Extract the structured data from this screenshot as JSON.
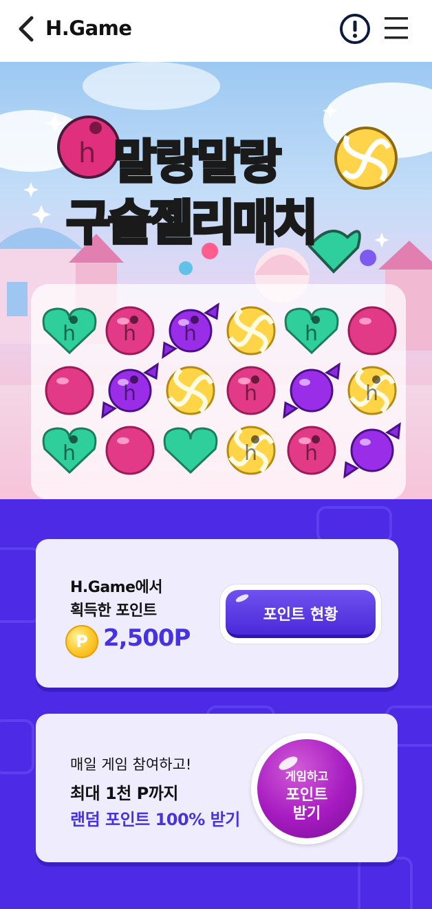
{
  "header": {
    "title": "H.Game",
    "back_icon": "chevron-left-icon",
    "info_icon": "info-circle-icon",
    "menu_icon": "hamburger-menu-icon"
  },
  "hero": {
    "title_line1": "말랑말랑",
    "title_line2": "구슬젤리매치",
    "board_tiles": [
      [
        "heart-h",
        "ball-h",
        "wrapped-h",
        "swirl",
        "heart-h",
        "ball"
      ],
      [
        "ball",
        "wrapped-h",
        "swirl",
        "ball-h",
        "wrapped",
        "swirl-h"
      ],
      [
        "heart-h",
        "ball",
        "heart",
        "swirl-h",
        "ball-h",
        "wrapped"
      ]
    ]
  },
  "points_card": {
    "label_line1": "H.Game에서",
    "label_line2": "획득한 포인트",
    "coin_symbol": "P",
    "value": "2,500P",
    "button_label": "포인트 현황"
  },
  "daily_card": {
    "line1": "매일 게임 참여하고!",
    "line2": "최대 1천 P까지",
    "line3": "랜덤 포인트 100% 받기",
    "button_line1": "게임하고",
    "button_line2": "포인트",
    "button_line3": "받기"
  },
  "colors": {
    "accent": "#4632e0",
    "background": "#4d2be6",
    "card": "#efedfd"
  }
}
